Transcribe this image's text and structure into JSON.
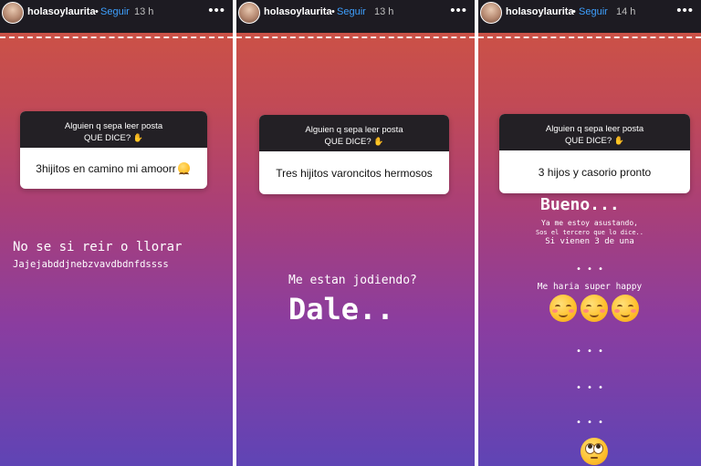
{
  "stories": [
    {
      "username": "holasoylaurita",
      "follow_label": "Seguir",
      "time": "13 h",
      "question_line1": "Alguien q sepa leer posta",
      "question_line2": "QUE DICE?",
      "answer": "3hijitos en camino mi amoorr",
      "reply_line1": "No se si reir o llorar",
      "reply_line2": "Jajejabddjnebzvavdbdnfdssss"
    },
    {
      "username": "holasoylaurita",
      "follow_label": "Seguir",
      "time": "13 h",
      "question_line1": "Alguien q sepa leer posta",
      "question_line2": "QUE DICE?",
      "answer": "Tres hijitos varoncitos hermosos",
      "reply_line1": "Me estan jodiendo?",
      "reply_line2": "Dale.."
    },
    {
      "username": "holasoylaurita",
      "follow_label": "Seguir",
      "time": "14 h",
      "question_line1": "Alguien q sepa leer posta",
      "question_line2": "QUE DICE?",
      "answer": "3 hijos y casorio pronto",
      "reply_big": "Bueno...",
      "reply_small1": "Ya me estoy asustando,",
      "reply_small2": "Sos el tercero que lo dice..",
      "reply_small3": "Si vienen 3 de una",
      "ellipsis": "• • •",
      "reply_happy": "Me haria super happy"
    }
  ],
  "header": {
    "separator": "•",
    "more_icon": "more-horizontal-icon"
  }
}
